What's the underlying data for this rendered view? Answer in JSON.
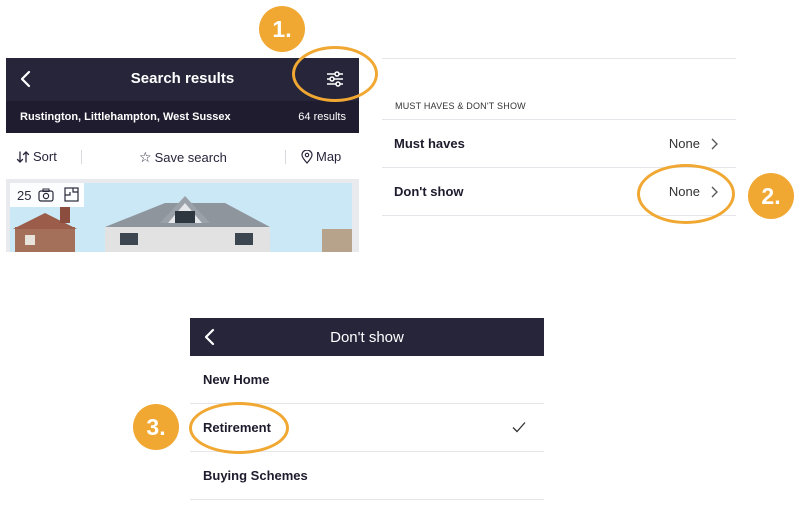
{
  "annotations": {
    "step1": "1.",
    "step2": "2.",
    "step3": "3.",
    "accent_color": "#f0a833"
  },
  "search_results": {
    "back_icon": "chevron-left-icon",
    "title": "Search results",
    "filter_icon": "sliders-icon",
    "location": "Rustington, Littlehampton, West Sussex",
    "results_count": "64 results",
    "toolbar": {
      "sort_label": "Sort",
      "save_search_label": "Save search",
      "map_label": "Map"
    },
    "listing": {
      "photo_count": "25",
      "camera_icon": "camera-icon",
      "floorplan_icon": "floorplan-icon"
    },
    "bar_color": "#27253a"
  },
  "must_haves_panel": {
    "section_heading": "MUST HAVES & DON'T SHOW",
    "rows": [
      {
        "label": "Must haves",
        "value": "None"
      },
      {
        "label": "Don't show",
        "value": "None"
      }
    ]
  },
  "dont_show_panel": {
    "title": "Don't show",
    "options": [
      {
        "label": "New Home",
        "checked": false
      },
      {
        "label": "Retirement",
        "checked": true
      },
      {
        "label": "Buying Schemes",
        "checked": false
      }
    ]
  }
}
